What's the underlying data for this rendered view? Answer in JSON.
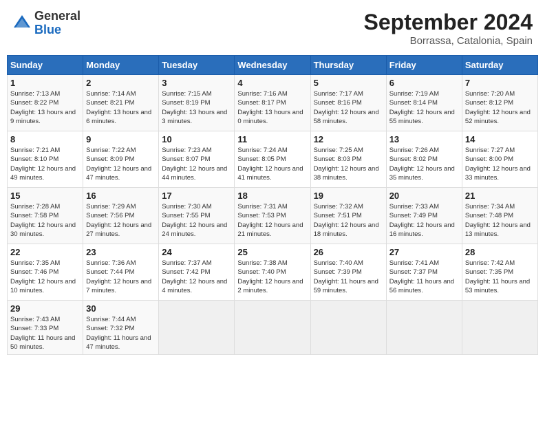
{
  "header": {
    "logo_general": "General",
    "logo_blue": "Blue",
    "month_year": "September 2024",
    "location": "Borrassa, Catalonia, Spain"
  },
  "days_of_week": [
    "Sunday",
    "Monday",
    "Tuesday",
    "Wednesday",
    "Thursday",
    "Friday",
    "Saturday"
  ],
  "weeks": [
    [
      {
        "day": "1",
        "sunrise": "Sunrise: 7:13 AM",
        "sunset": "Sunset: 8:22 PM",
        "daylight": "Daylight: 13 hours and 9 minutes."
      },
      {
        "day": "2",
        "sunrise": "Sunrise: 7:14 AM",
        "sunset": "Sunset: 8:21 PM",
        "daylight": "Daylight: 13 hours and 6 minutes."
      },
      {
        "day": "3",
        "sunrise": "Sunrise: 7:15 AM",
        "sunset": "Sunset: 8:19 PM",
        "daylight": "Daylight: 13 hours and 3 minutes."
      },
      {
        "day": "4",
        "sunrise": "Sunrise: 7:16 AM",
        "sunset": "Sunset: 8:17 PM",
        "daylight": "Daylight: 13 hours and 0 minutes."
      },
      {
        "day": "5",
        "sunrise": "Sunrise: 7:17 AM",
        "sunset": "Sunset: 8:16 PM",
        "daylight": "Daylight: 12 hours and 58 minutes."
      },
      {
        "day": "6",
        "sunrise": "Sunrise: 7:19 AM",
        "sunset": "Sunset: 8:14 PM",
        "daylight": "Daylight: 12 hours and 55 minutes."
      },
      {
        "day": "7",
        "sunrise": "Sunrise: 7:20 AM",
        "sunset": "Sunset: 8:12 PM",
        "daylight": "Daylight: 12 hours and 52 minutes."
      }
    ],
    [
      {
        "day": "8",
        "sunrise": "Sunrise: 7:21 AM",
        "sunset": "Sunset: 8:10 PM",
        "daylight": "Daylight: 12 hours and 49 minutes."
      },
      {
        "day": "9",
        "sunrise": "Sunrise: 7:22 AM",
        "sunset": "Sunset: 8:09 PM",
        "daylight": "Daylight: 12 hours and 47 minutes."
      },
      {
        "day": "10",
        "sunrise": "Sunrise: 7:23 AM",
        "sunset": "Sunset: 8:07 PM",
        "daylight": "Daylight: 12 hours and 44 minutes."
      },
      {
        "day": "11",
        "sunrise": "Sunrise: 7:24 AM",
        "sunset": "Sunset: 8:05 PM",
        "daylight": "Daylight: 12 hours and 41 minutes."
      },
      {
        "day": "12",
        "sunrise": "Sunrise: 7:25 AM",
        "sunset": "Sunset: 8:03 PM",
        "daylight": "Daylight: 12 hours and 38 minutes."
      },
      {
        "day": "13",
        "sunrise": "Sunrise: 7:26 AM",
        "sunset": "Sunset: 8:02 PM",
        "daylight": "Daylight: 12 hours and 35 minutes."
      },
      {
        "day": "14",
        "sunrise": "Sunrise: 7:27 AM",
        "sunset": "Sunset: 8:00 PM",
        "daylight": "Daylight: 12 hours and 33 minutes."
      }
    ],
    [
      {
        "day": "15",
        "sunrise": "Sunrise: 7:28 AM",
        "sunset": "Sunset: 7:58 PM",
        "daylight": "Daylight: 12 hours and 30 minutes."
      },
      {
        "day": "16",
        "sunrise": "Sunrise: 7:29 AM",
        "sunset": "Sunset: 7:56 PM",
        "daylight": "Daylight: 12 hours and 27 minutes."
      },
      {
        "day": "17",
        "sunrise": "Sunrise: 7:30 AM",
        "sunset": "Sunset: 7:55 PM",
        "daylight": "Daylight: 12 hours and 24 minutes."
      },
      {
        "day": "18",
        "sunrise": "Sunrise: 7:31 AM",
        "sunset": "Sunset: 7:53 PM",
        "daylight": "Daylight: 12 hours and 21 minutes."
      },
      {
        "day": "19",
        "sunrise": "Sunrise: 7:32 AM",
        "sunset": "Sunset: 7:51 PM",
        "daylight": "Daylight: 12 hours and 18 minutes."
      },
      {
        "day": "20",
        "sunrise": "Sunrise: 7:33 AM",
        "sunset": "Sunset: 7:49 PM",
        "daylight": "Daylight: 12 hours and 16 minutes."
      },
      {
        "day": "21",
        "sunrise": "Sunrise: 7:34 AM",
        "sunset": "Sunset: 7:48 PM",
        "daylight": "Daylight: 12 hours and 13 minutes."
      }
    ],
    [
      {
        "day": "22",
        "sunrise": "Sunrise: 7:35 AM",
        "sunset": "Sunset: 7:46 PM",
        "daylight": "Daylight: 12 hours and 10 minutes."
      },
      {
        "day": "23",
        "sunrise": "Sunrise: 7:36 AM",
        "sunset": "Sunset: 7:44 PM",
        "daylight": "Daylight: 12 hours and 7 minutes."
      },
      {
        "day": "24",
        "sunrise": "Sunrise: 7:37 AM",
        "sunset": "Sunset: 7:42 PM",
        "daylight": "Daylight: 12 hours and 4 minutes."
      },
      {
        "day": "25",
        "sunrise": "Sunrise: 7:38 AM",
        "sunset": "Sunset: 7:40 PM",
        "daylight": "Daylight: 12 hours and 2 minutes."
      },
      {
        "day": "26",
        "sunrise": "Sunrise: 7:40 AM",
        "sunset": "Sunset: 7:39 PM",
        "daylight": "Daylight: 11 hours and 59 minutes."
      },
      {
        "day": "27",
        "sunrise": "Sunrise: 7:41 AM",
        "sunset": "Sunset: 7:37 PM",
        "daylight": "Daylight: 11 hours and 56 minutes."
      },
      {
        "day": "28",
        "sunrise": "Sunrise: 7:42 AM",
        "sunset": "Sunset: 7:35 PM",
        "daylight": "Daylight: 11 hours and 53 minutes."
      }
    ],
    [
      {
        "day": "29",
        "sunrise": "Sunrise: 7:43 AM",
        "sunset": "Sunset: 7:33 PM",
        "daylight": "Daylight: 11 hours and 50 minutes."
      },
      {
        "day": "30",
        "sunrise": "Sunrise: 7:44 AM",
        "sunset": "Sunset: 7:32 PM",
        "daylight": "Daylight: 11 hours and 47 minutes."
      },
      null,
      null,
      null,
      null,
      null
    ]
  ]
}
